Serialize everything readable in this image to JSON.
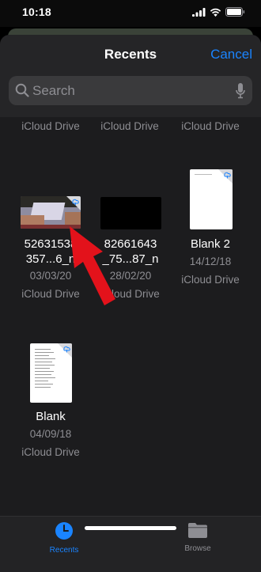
{
  "status": {
    "time": "10:18"
  },
  "nav": {
    "title": "Recents",
    "cancel": "Cancel"
  },
  "search": {
    "placeholder": "Search"
  },
  "top_row": [
    {
      "location": "iCloud Drive"
    },
    {
      "location": "iCloud Drive"
    },
    {
      "location": "iCloud Drive"
    }
  ],
  "files": [
    {
      "name_line1": "52631538",
      "name_line2": "357...6_n",
      "date": "03/03/20",
      "location": "iCloud Drive",
      "thumb": "photo"
    },
    {
      "name_line1": "82661643",
      "name_line2": "_75...87_n",
      "date": "28/02/20",
      "location": "iCloud Drive",
      "thumb": "dark"
    },
    {
      "name_line1": "Blank 2",
      "date": "14/12/18",
      "location": "iCloud Drive",
      "thumb": "document"
    },
    {
      "name_line1": "Blank",
      "date": "04/09/18",
      "location": "iCloud Drive",
      "thumb": "text-document"
    }
  ],
  "tabs": [
    {
      "label": "Recents",
      "active": true,
      "icon": "clock-icon"
    },
    {
      "label": "Browse",
      "active": false,
      "icon": "folder-icon"
    }
  ],
  "colors": {
    "accent": "#1a84ff",
    "annotation_arrow": "#e3121b"
  }
}
